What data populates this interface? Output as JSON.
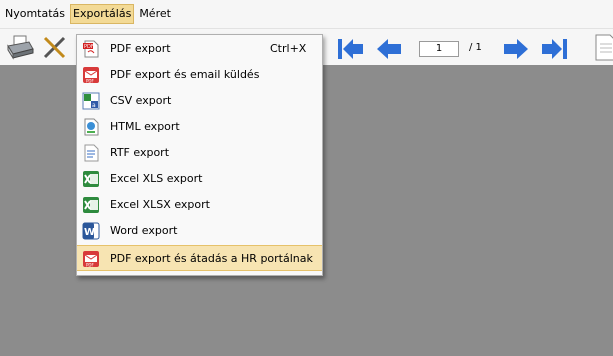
{
  "menubar": {
    "items": [
      {
        "label": "Nyomtatás"
      },
      {
        "label": "Exportálás"
      },
      {
        "label": "Méret"
      }
    ]
  },
  "toolbar": {
    "page_current": "1",
    "page_total": "/ 1"
  },
  "dropdown": {
    "items": [
      {
        "label": "PDF export",
        "shortcut": "Ctrl+X",
        "icon": "pdf-icon"
      },
      {
        "label": "PDF export és email küldés",
        "icon": "pdf-email-icon"
      },
      {
        "label": "CSV export",
        "icon": "csv-icon"
      },
      {
        "label": "HTML export",
        "icon": "html-icon"
      },
      {
        "label": "RTF export",
        "icon": "rtf-icon"
      },
      {
        "label": "Excel XLS export",
        "icon": "excel-icon"
      },
      {
        "label": "Excel XLSX export",
        "icon": "excel-icon"
      },
      {
        "label": "Word export",
        "icon": "word-icon"
      },
      {
        "label": "PDF export és átadás a HR portálnak",
        "icon": "pdf-upload-icon"
      }
    ]
  },
  "colors": {
    "menu_highlight": "#f3da96",
    "item_highlight": "#f7e4b2",
    "workspace": "#8c8c8c",
    "nav_arrow": "#2e6fd6"
  }
}
